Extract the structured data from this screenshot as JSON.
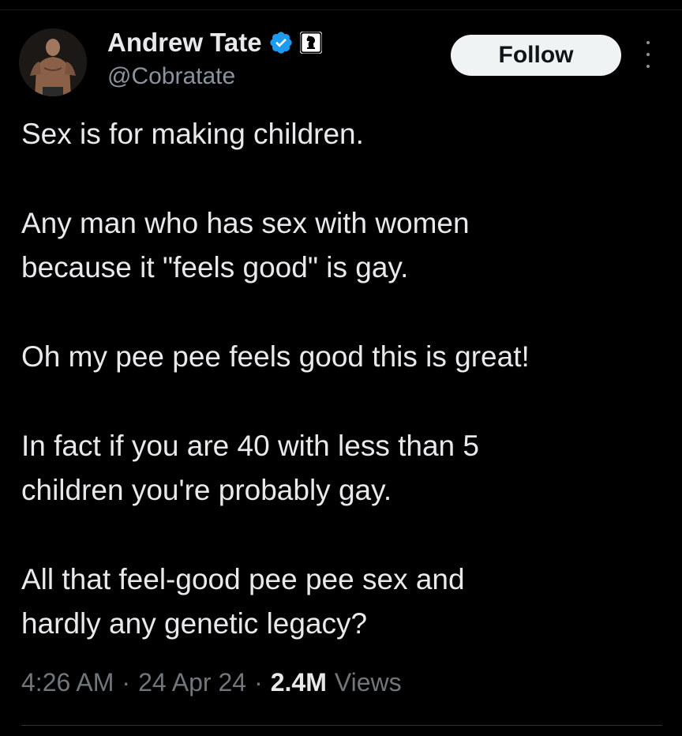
{
  "author": {
    "display_name": "Andrew Tate",
    "handle": "@Cobratate"
  },
  "follow_button_label": "Follow",
  "tweet": {
    "paragraphs": [
      "Sex is for making children.",
      "Any man who has sex with women\nbecause it \"feels good\" is gay.",
      "Oh my pee pee feels good this is great!",
      "In fact if you are 40 with less than 5\nchildren you're probably gay.",
      "All that feel-good pee pee sex and\nhardly any genetic legacy?"
    ]
  },
  "meta": {
    "time": "4:26 AM",
    "separator": "·",
    "date": "24 Apr 24",
    "views_count": "2.4M",
    "views_label": "Views"
  },
  "colors": {
    "background": "#000000",
    "text_primary": "#e7e9ea",
    "text_secondary": "#71767b",
    "verified_badge": "#1d9bf0",
    "follow_button_bg": "#eff3f4"
  },
  "icons": {
    "verified": "verified-badge-icon",
    "affiliate": "affiliate-chess-knight-icon",
    "more": "more-options-icon"
  }
}
